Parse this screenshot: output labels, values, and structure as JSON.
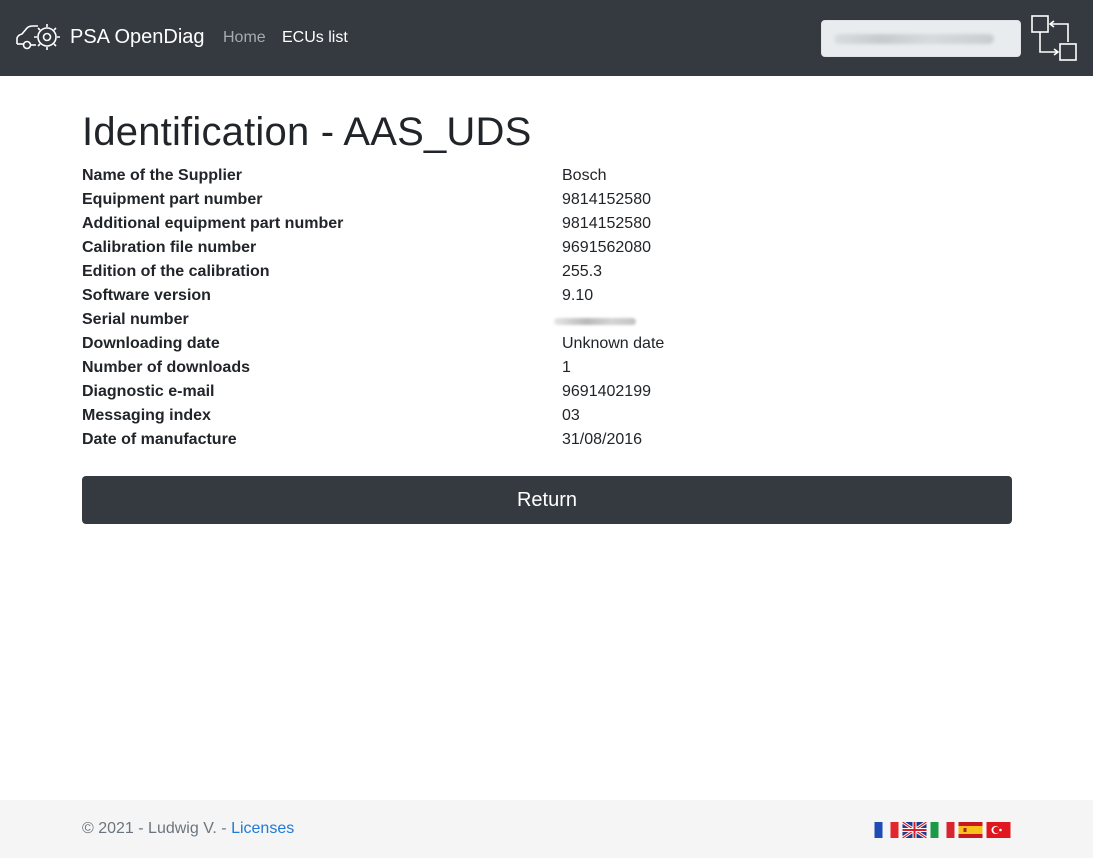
{
  "navbar": {
    "brand": "PSA OpenDiag",
    "links": [
      "Home",
      "ECUs list"
    ],
    "search_value": "",
    "connection_icon": "connection-icon",
    "brand_icon": "car-gear-icon"
  },
  "main": {
    "title": "Identification - AAS_UDS",
    "rows": [
      {
        "label": "Name of the Supplier",
        "value": "Bosch"
      },
      {
        "label": "Equipment part number",
        "value": "9814152580"
      },
      {
        "label": "Additional equipment part number",
        "value": "9814152580"
      },
      {
        "label": "Calibration file number",
        "value": "9691562080"
      },
      {
        "label": "Edition of the calibration",
        "value": "255.3"
      },
      {
        "label": "Software version",
        "value": "9.10"
      },
      {
        "label": "Serial number",
        "value": ""
      },
      {
        "label": "Downloading date",
        "value": "Unknown date"
      },
      {
        "label": "Number of downloads",
        "value": "1"
      },
      {
        "label": "Diagnostic e-mail",
        "value": "9691402199"
      },
      {
        "label": "Messaging index",
        "value": "03"
      },
      {
        "label": "Date of manufacture",
        "value": "31/08/2016"
      }
    ],
    "return_label": "Return"
  },
  "footer": {
    "copyright": "© 2021 - Ludwig V. - ",
    "licenses_link": "Licenses",
    "flags": [
      "fr-flag",
      "gb-flag",
      "it-flag",
      "es-flag",
      "tr-flag"
    ]
  },
  "colors": {
    "navbar_bg": "#343a40",
    "button_bg": "#343a40",
    "link": "#1e7ad6",
    "footer_bg": "#f5f5f5"
  }
}
